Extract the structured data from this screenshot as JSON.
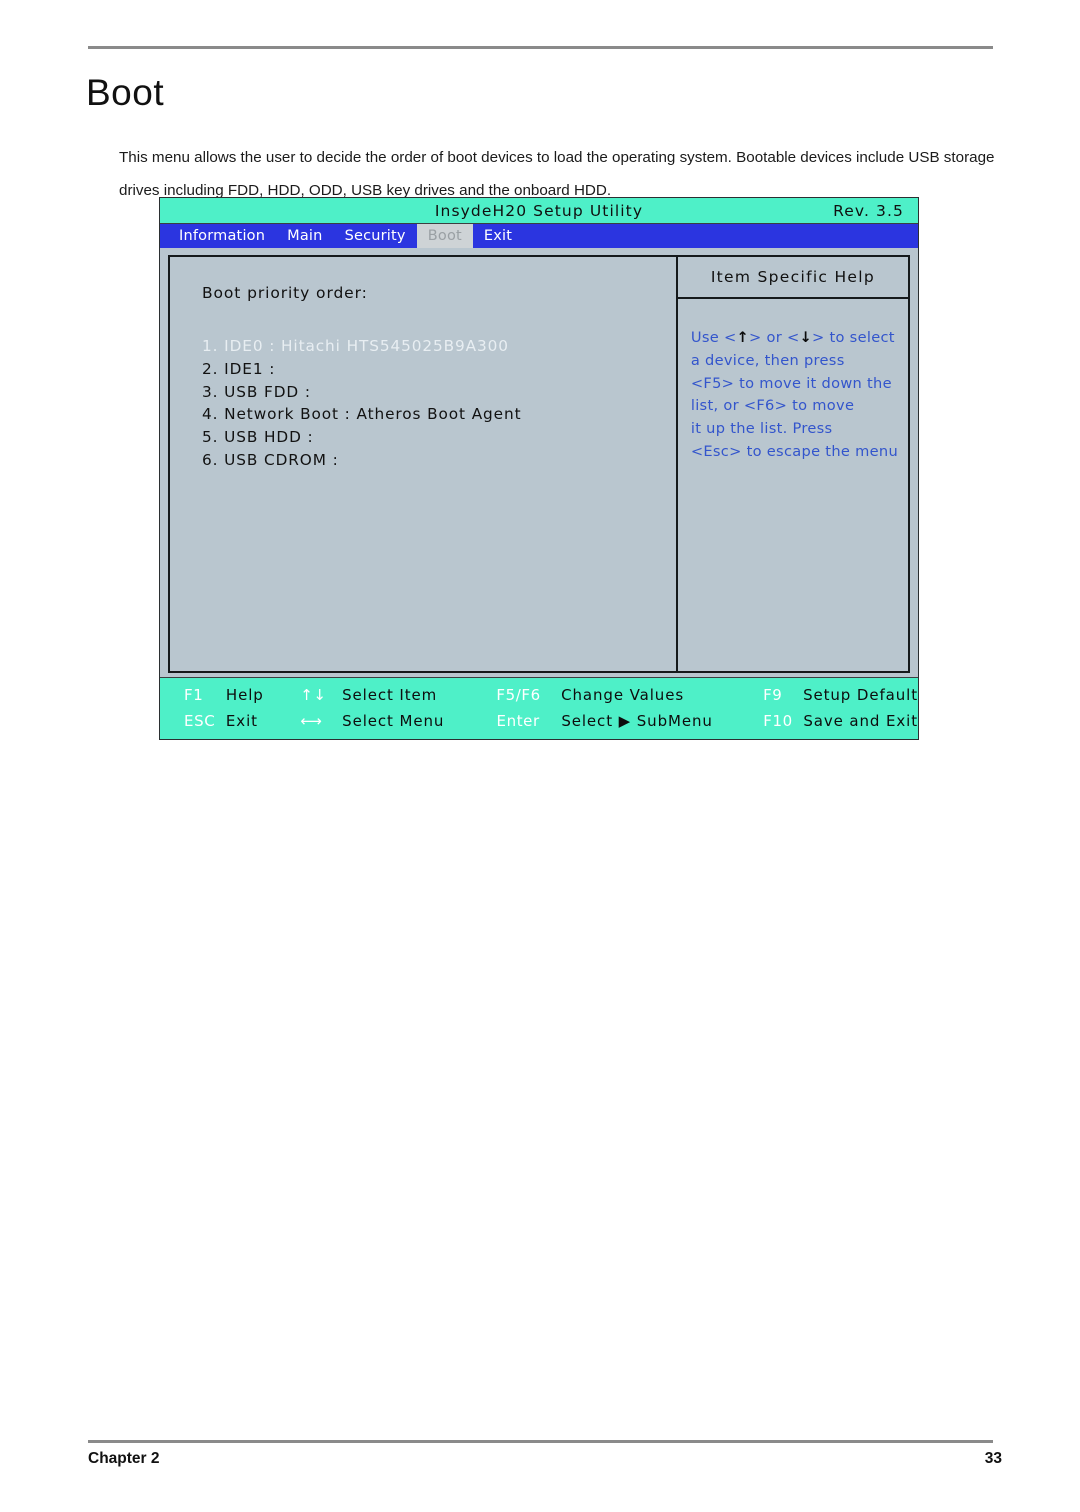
{
  "document": {
    "title": "Boot",
    "intro": "This menu allows the user to decide the order of boot devices to load the operating system. Bootable devices include USB storage drives including FDD, HDD, ODD, USB key drives and the onboard HDD.",
    "footer_left": "Chapter 2",
    "footer_right": "33"
  },
  "bios": {
    "utility_title": "InsydeH20 Setup Utility",
    "revision": "Rev. 3.5",
    "tabs": [
      {
        "label": "Information",
        "active": false
      },
      {
        "label": "Main",
        "active": false
      },
      {
        "label": "Security",
        "active": false
      },
      {
        "label": "Boot",
        "active": true
      },
      {
        "label": "Exit",
        "active": false
      }
    ],
    "main_panel": {
      "heading": "Boot priority order:",
      "items": [
        {
          "label": "1. IDE0 : Hitachi HTS545025B9A300",
          "selected": true
        },
        {
          "label": "2. IDE1 :",
          "selected": false
        },
        {
          "label": "3. USB FDD :",
          "selected": false
        },
        {
          "label": "4. Network Boot : Atheros Boot Agent",
          "selected": false
        },
        {
          "label": "5. USB HDD :",
          "selected": false
        },
        {
          "label": "6. USB CDROM :",
          "selected": false
        }
      ]
    },
    "help_panel": {
      "header": "Item Specific Help",
      "lines": [
        {
          "pre": "Use <",
          "arrow": "↑",
          "mid": "> or <",
          "arrow2": "↓",
          "post": "> to select"
        },
        {
          "text": "a device, then press"
        },
        {
          "text": "<F5> to move it down the"
        },
        {
          "text": "list, or <F6> to move"
        },
        {
          "text": "it up the list. Press"
        },
        {
          "text": "<Esc> to escape the menu"
        }
      ]
    },
    "function_keys": {
      "row1": [
        {
          "key": "F1",
          "action": "Help"
        },
        {
          "key": "↑↓",
          "action": "Select  Item"
        },
        {
          "key": "F5/F6",
          "action": "Change Values"
        },
        {
          "key": "F9",
          "action": "Setup Default"
        }
      ],
      "row2": [
        {
          "key": "ESC",
          "action": "Exit"
        },
        {
          "key": "⟷",
          "action": "Select  Menu"
        },
        {
          "key": "Enter",
          "action": "Select  ▶ SubMenu"
        },
        {
          "key": "F10",
          "action": "Save and Exit"
        }
      ]
    },
    "colors": {
      "titlebar": "#4ef0c8",
      "tabbar": "#2b35e0",
      "panel_bg": "#b9c6cf",
      "help_text": "#3355cc",
      "selected_item": "#e8eef2"
    }
  }
}
